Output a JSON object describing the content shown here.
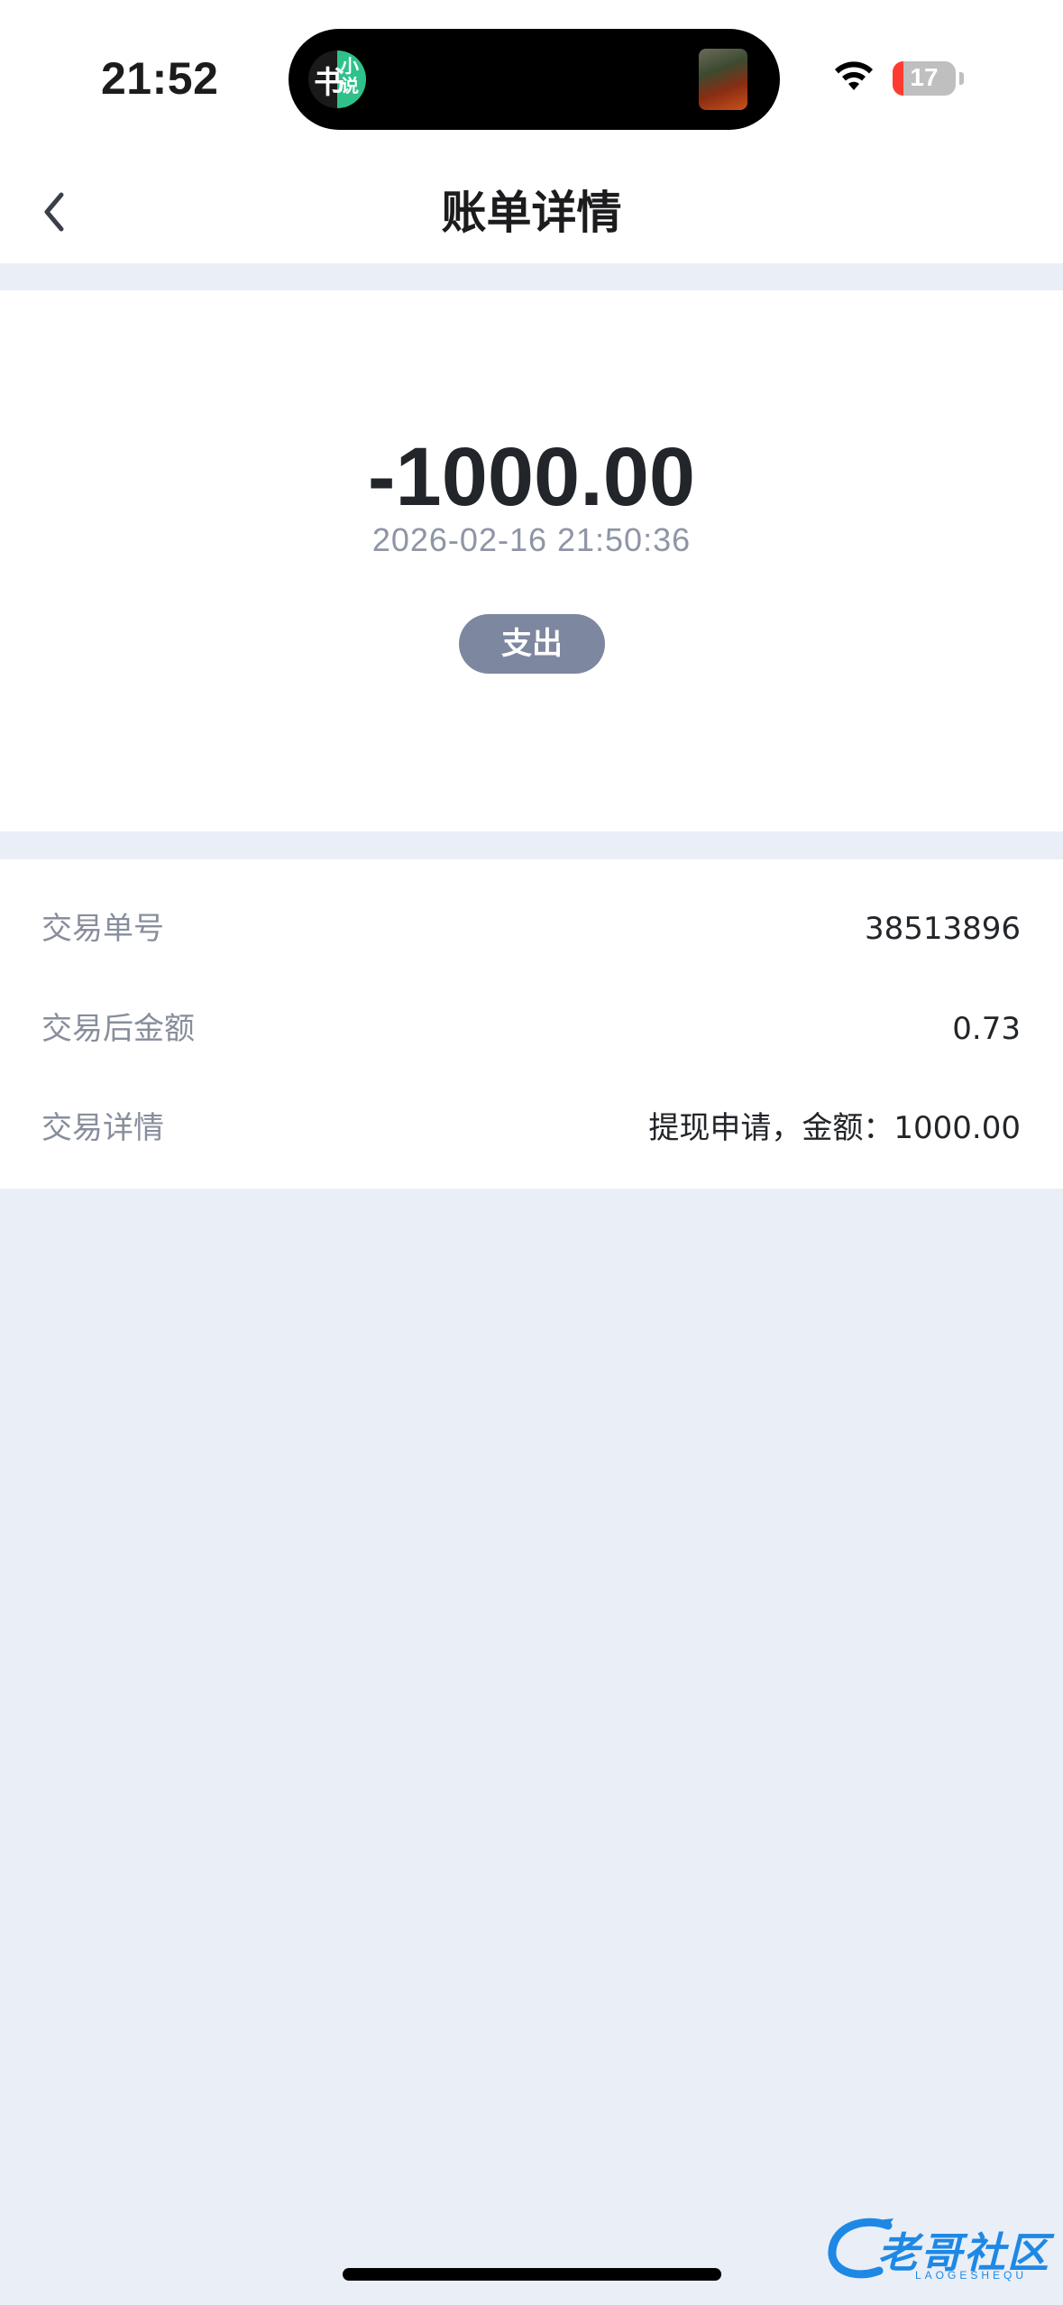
{
  "status_bar": {
    "time": "21:52",
    "battery_level": "17",
    "battery_fraction": 0.17,
    "island_app_glyph_1": "书",
    "island_app_glyph_2": "小说"
  },
  "nav": {
    "title": "账单详情",
    "back_icon": "chevron-left-icon"
  },
  "summary": {
    "amount": "-1000.00",
    "datetime": "2026-02-16 21:50:36",
    "type_label": "支出"
  },
  "details": {
    "rows": [
      {
        "label": "交易单号",
        "value": "38513896"
      },
      {
        "label": "交易后金额",
        "value": "0.73"
      },
      {
        "label": "交易详情",
        "value": "提现申请，金额：1000.00"
      }
    ]
  },
  "watermark": {
    "text": "老哥社区",
    "sub": "LAOGESHEQU"
  },
  "colors": {
    "page_background": "#e9eef7",
    "badge_background": "#7d879f",
    "label_gray": "#878e9c",
    "battery_low": "#ff3b30",
    "watermark_blue": "#1e88e5"
  }
}
